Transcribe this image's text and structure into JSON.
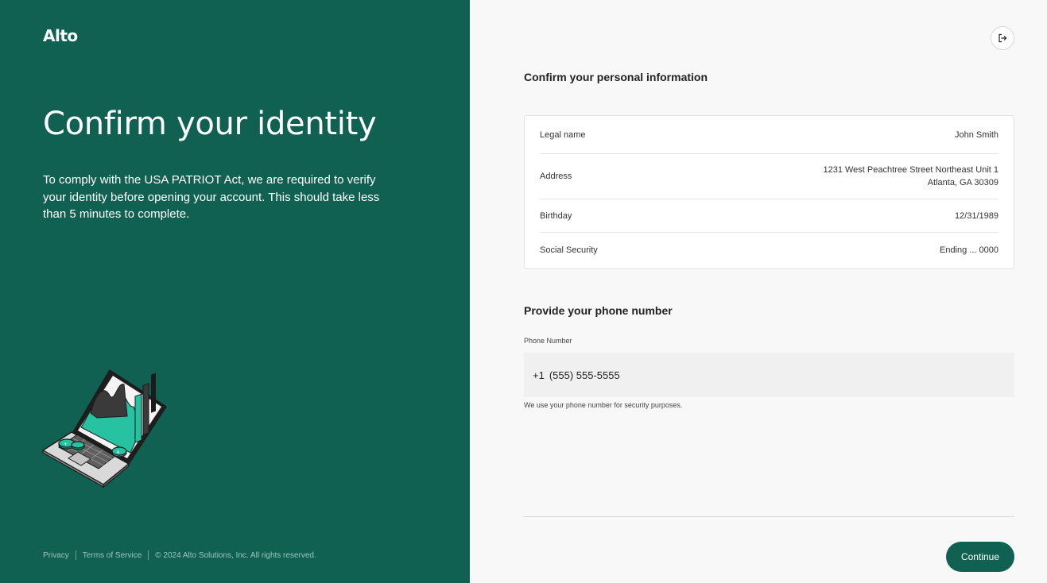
{
  "brand": {
    "logo_text": "Alto",
    "primary_color": "#106151",
    "background_color": "#f8f8f8"
  },
  "hero": {
    "title": "Confirm your identity",
    "description": "To comply with the USA PATRIOT Act, we are required to verify your identity before opening your account. This should take less than 5 minutes to complete.",
    "illustration": "laptop-chart-illustration"
  },
  "footer": {
    "privacy": "Privacy",
    "terms": "Terms of Service",
    "copyright": "© 2024 Alto Solutions, Inc. All rights reserved."
  },
  "header": {
    "exit_icon": "logout-icon"
  },
  "personal_info": {
    "title": "Confirm your personal information",
    "rows": [
      {
        "label": "Legal name",
        "value": "John Smith"
      },
      {
        "label": "Address",
        "value_line1": "1231 West Peachtree Street Northeast Unit 1",
        "value_line2": "Atlanta, GA 30309"
      },
      {
        "label": "Birthday",
        "value": "12/31/1989"
      },
      {
        "label": "Social Security",
        "value": "Ending ... 0000"
      }
    ]
  },
  "phone": {
    "title": "Provide your phone number",
    "label": "Phone Number",
    "country_code": "+1",
    "value": "(555) 555-5555",
    "helper": "We use your phone number for security purposes."
  },
  "actions": {
    "continue_label": "Continue"
  }
}
